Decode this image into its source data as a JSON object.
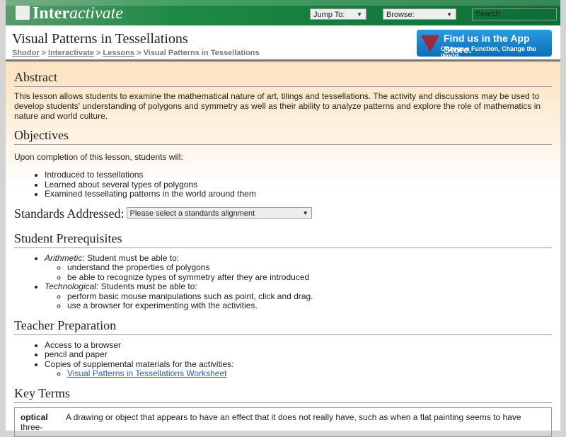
{
  "header": {
    "logo_bold": "Inter",
    "logo_italic": "activate",
    "jump_to": "Jump To:",
    "browse": "Browse:",
    "search_placeholder": "Search"
  },
  "page": {
    "title": "Visual Patterns in Tessellations",
    "breadcrumb": [
      "Shodor",
      "Interactivate",
      "Lessons",
      "Visual Patterns in Tessellations"
    ],
    "app_store_line1": "Find us in the App Store.",
    "app_store_line2": "Change a Function, Change the World"
  },
  "abstract": {
    "heading": "Abstract",
    "text": "This lesson allows students to examine the mathematical nature of art, tilings and tessellations. The activity and discussions may be used to develop students' understanding of polygons and symmetry as well as their ability to analyze patterns and explore the role of mathematics in nature and world culture."
  },
  "objectives": {
    "heading": "Objectives",
    "intro": "Upon completion of this lesson, students will:",
    "items": [
      "Introduced to tessellations",
      "Learned about several types of polygons",
      "Examined tessellating patterns in the world around them"
    ]
  },
  "standards": {
    "heading": "Standards Addressed:",
    "select": "Please select a standards alignment"
  },
  "prereq": {
    "heading": "Student Prerequisites",
    "a_label": "Arithmetic:",
    "a_text": " Student must be able to:",
    "a_items": [
      "understand the properties of polygons",
      "be able to recognize types of symmetry after they are introduced"
    ],
    "t_label": "Technological:",
    "t_text": " Students must be able to:",
    "t_items": [
      "perform basic mouse manipulations such as point, click and drag.",
      "use a browser for experimenting with the activities."
    ]
  },
  "teacher": {
    "heading": "Teacher Preparation",
    "items": [
      "Access to a browser",
      "pencil and paper",
      "Copies of supplemental materials for the activities:"
    ],
    "link": "Visual Patterns in Tessellations Worksheet"
  },
  "key_terms": {
    "heading": "Key Terms",
    "term": "optical",
    "definition": "A drawing or object that appears to have an effect that it does not really have, such as when a flat painting seems to have three-"
  }
}
